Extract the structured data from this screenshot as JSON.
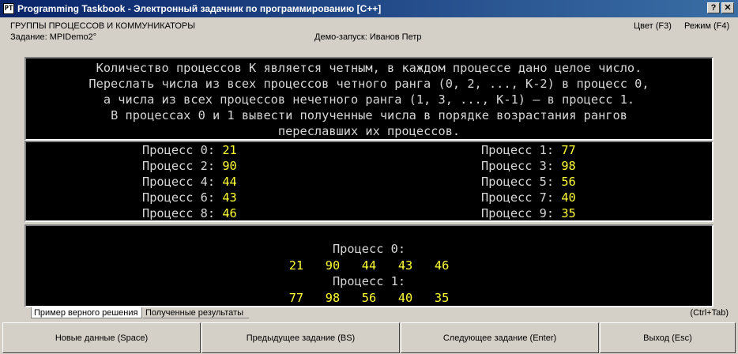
{
  "window": {
    "icon_label": "PT",
    "title": "Programming Taskbook - Электронный задачник по программированию [C++]",
    "help_glyph": "?",
    "close_glyph": "✕"
  },
  "header": {
    "group": "ГРУППЫ ПРОЦЕССОВ И КОММУНИКАТОРЫ",
    "task": "Задание: MPIDemo2°",
    "demo": "Демо-запуск: Иванов Петр",
    "color_menu": "Цвет (F3)",
    "mode_menu": "Режим (F4)"
  },
  "task_text": [
    "Количество процессов K является четным, в каждом процессе дано целое число.",
    "Переслать числа из всех процессов четного ранга (0, 2, ..., K-2) в процесс 0,",
    "а числа из всех процессов нечетного ранга (1, 3, ..., K-1) — в процесс 1.",
    "В процессах 0 и 1 вывести полученные числа в порядке возрастания рангов",
    "переславших их процессов."
  ],
  "input": {
    "left": [
      {
        "label": "Процесс 0: ",
        "value": "21"
      },
      {
        "label": "Процесс 2: ",
        "value": "90"
      },
      {
        "label": "Процесс 4: ",
        "value": "44"
      },
      {
        "label": "Процесс 6: ",
        "value": "43"
      },
      {
        "label": "Процесс 8: ",
        "value": "46"
      }
    ],
    "right": [
      {
        "label": "Процесс 1: ",
        "value": "77"
      },
      {
        "label": "Процесс 3: ",
        "value": "98"
      },
      {
        "label": "Процесс 5: ",
        "value": "56"
      },
      {
        "label": "Процесс 7: ",
        "value": "40"
      },
      {
        "label": "Процесс 9: ",
        "value": "35"
      }
    ]
  },
  "result": {
    "p0_label": "Процесс 0:",
    "p0_values": "21   90   44   43   46",
    "p1_label": "Процесс 1:",
    "p1_values": "77   98   56   40   35"
  },
  "tabs": {
    "active": "Пример верного решения",
    "inactive": "Полученные результаты",
    "hint": "(Ctrl+Tab)"
  },
  "buttons": {
    "new_data": "Новые данные (Space)",
    "prev_task": "Предыдущее задание (BS)",
    "next_task": "Следующее задание (Enter)",
    "exit": "Выход (Esc)"
  },
  "colors": {
    "title_bar": "#0a246a",
    "panel_bg": "#000000",
    "data_value": "#ffff33",
    "panel_text": "#d6d6d6"
  }
}
